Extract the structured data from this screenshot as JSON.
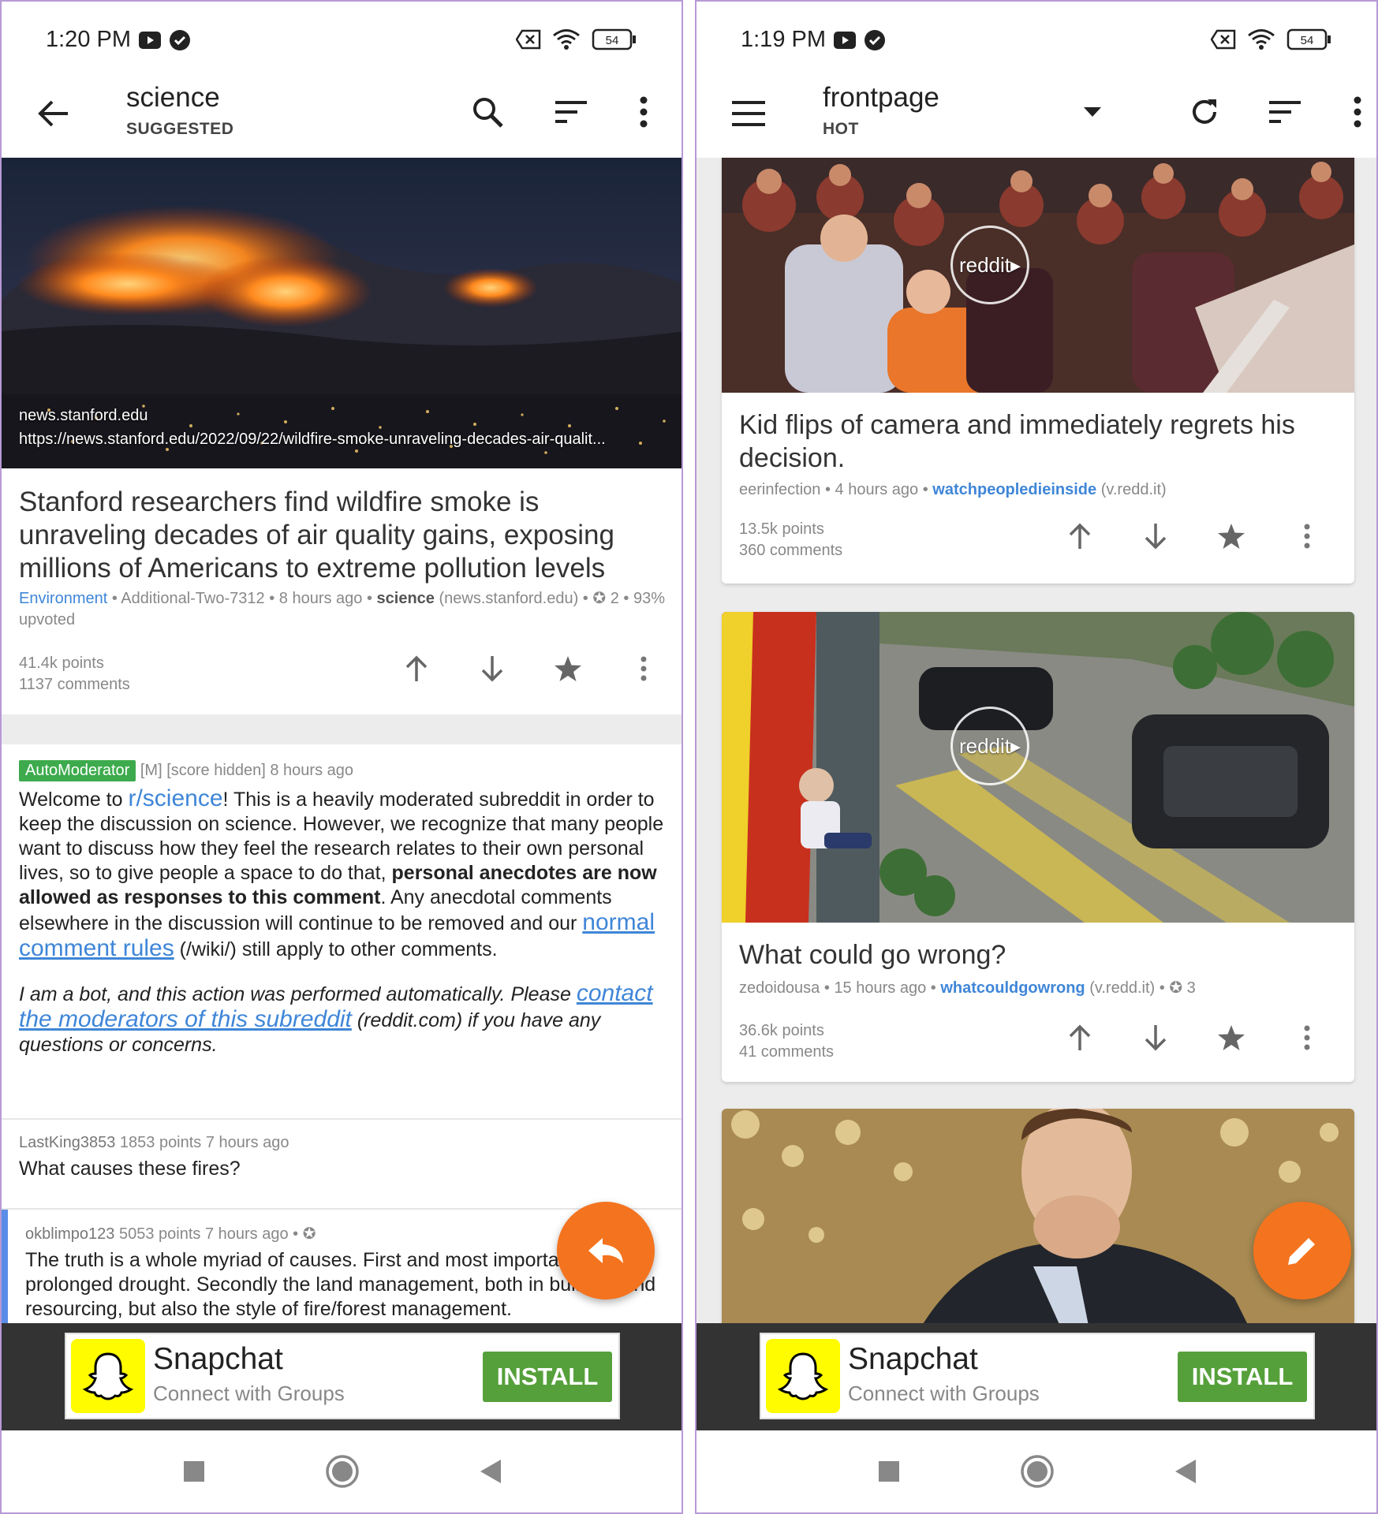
{
  "left": {
    "status": {
      "time": "1:20 PM",
      "battery": "54"
    },
    "appbar": {
      "title": "science",
      "subtitle": "SUGGESTED"
    },
    "post": {
      "domain": "news.stanford.edu",
      "url": "https://news.stanford.edu/2022/09/22/wildfire-smoke-unraveling-decades-air-qualit...",
      "title": "Stanford researchers find wildfire smoke is unraveling decades of air quality gains, exposing millions of Americans to extreme pollution levels",
      "flair": "Environment",
      "author": "Additional-Two-7312",
      "age": "8 hours ago",
      "subreddit": "science",
      "source": "(news.stanford.edu)",
      "awards": "2",
      "upvoted": "93% upvoted",
      "points": "41.4k points",
      "comments": "1137 comments"
    },
    "comments": {
      "automod": {
        "tag": "AutoModerator",
        "meta": "[M] [score hidden] 8 hours ago",
        "p1_a": "Welcome to ",
        "p1_link": "r/science",
        "p1_b": "! This is a heavily moderated subreddit in order to keep the discussion on science. However, we recognize that many people want to discuss how they feel the research relates to their own personal lives, so to give people a space to do that, ",
        "p1_bold": "personal anecdotes are now allowed as responses to this comment",
        "p1_c": ". Any anecdotal comments elsewhere in the discussion will continue to be removed and our ",
        "p1_link2": "normal comment rules",
        "p1_d": " (/wiki/) still apply to other comments.",
        "p2_a": "I am a bot, and this action was performed automatically. Please ",
        "p2_link": "contact the moderators of this subreddit",
        "p2_b": " (reddit.com) if you have any questions or concerns."
      },
      "c1": {
        "author": "LastKing3853",
        "meta": "1853 points 7 hours ago",
        "text": "What causes these fires?"
      },
      "c2": {
        "author": "okblimpo123",
        "meta": "5053 points 7 hours ago •",
        "text": "The truth is a whole myriad of causes. First and most important is the prolonged drought. Secondly the land management, both in building and resourcing, but also the style of fire/forest management."
      }
    },
    "ad": {
      "name": "Snapchat",
      "tagline": "Connect with Groups",
      "cta": "INSTALL"
    }
  },
  "right": {
    "status": {
      "time": "1:19 PM",
      "battery": "54"
    },
    "appbar": {
      "title": "frontpage",
      "subtitle": "HOT"
    },
    "posts": [
      {
        "badge": "reddit▸",
        "title": "Kid flips of camera and immediately regrets his decision.",
        "author": "eerinfection",
        "age": "4 hours ago",
        "subreddit": "watchpeopledieinside",
        "source": "(v.redd.it)",
        "points": "13.5k points",
        "comments": "360 comments"
      },
      {
        "badge": "reddit▸",
        "title": "What could go wrong?",
        "author": "zedoidousa",
        "age": "15 hours ago",
        "subreddit": "whatcouldgowrong",
        "source": "(v.redd.it)",
        "awards": "3",
        "points": "36.6k points",
        "comments": "41 comments"
      }
    ],
    "ad": {
      "name": "Snapchat",
      "tagline": "Connect with Groups",
      "cta": "INSTALL"
    }
  }
}
